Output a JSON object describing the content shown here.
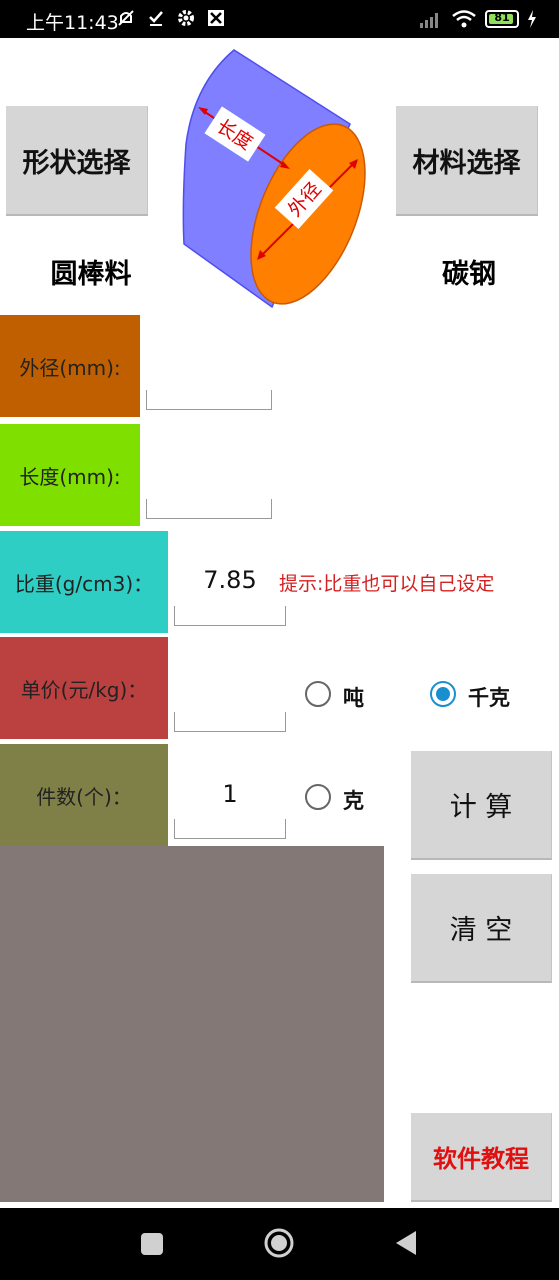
{
  "status_bar": {
    "time": "上午11:43",
    "battery": "81",
    "icons": [
      "mute-icon",
      "check-icon",
      "gear-icon",
      "app-icon",
      "signal-icon",
      "wifi-icon",
      "battery-icon",
      "charging-icon"
    ]
  },
  "shape": {
    "button_label": "形状选择",
    "selected": "圆棒料",
    "diagram_length_label": "长度",
    "diagram_diameter_label": "外径"
  },
  "material": {
    "button_label": "材料选择",
    "selected": "碳钢"
  },
  "fields": {
    "diameter_label": "外径(mm):",
    "diameter_value": "",
    "length_label": "长度(mm):",
    "length_value": "",
    "density_label": "比重(g/cm3)：",
    "density_value": "7.85",
    "price_label": "单价(元/kg)：",
    "price_value": "",
    "count_label": "件数(个)：",
    "count_value": "1"
  },
  "hint": "提示:比重也可以自己设定",
  "units": {
    "ton": "吨",
    "kilogram": "千克",
    "gram": "克",
    "selected": "千克"
  },
  "actions": {
    "calculate": "计 算",
    "clear": "清 空",
    "tutorial": "软件教程"
  },
  "colors": {
    "diameter_row": "#bf5f00",
    "length_row": "#7fe000",
    "density_row": "#2ecec4",
    "price_row": "#bb4141",
    "count_row": "#7f7f48",
    "result_area": "#847877",
    "tutorial_text": "#e01010",
    "radio_accent": "#1a8fd0"
  }
}
